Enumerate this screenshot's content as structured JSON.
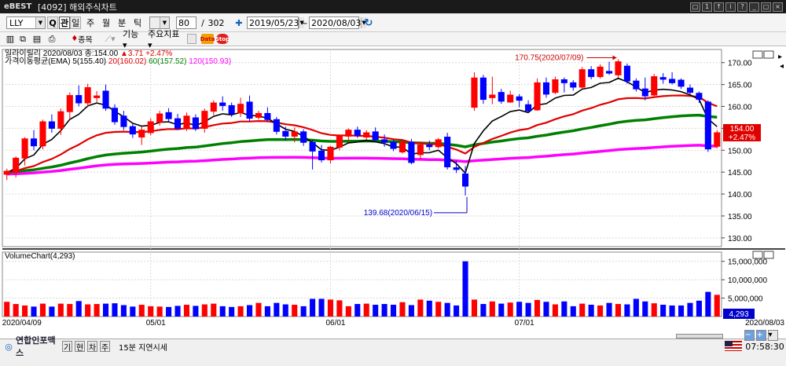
{
  "app": {
    "logo": "eBEST",
    "title": "[4092] 해외주식차트",
    "window_buttons": [
      "□",
      "1",
      "↑",
      "i",
      "?",
      "_",
      "▢",
      "×"
    ]
  },
  "toolbar": {
    "symbol": "LLY",
    "search_btn": "Q",
    "period_tabs": [
      "관",
      "일",
      "주",
      "월",
      "분",
      "틱"
    ],
    "active_tab": "일",
    "count": "80",
    "total": "302",
    "date_from": "2019/05/23",
    "date_to": "2020/08/03",
    "date_sep": "~",
    "menu_gi": "기능 ▾",
    "menu_indicator": "주요지표 ▾",
    "row2_small": "종목",
    "icon_data": "Data",
    "icon_stop": "Stop"
  },
  "legend": {
    "price_name": "일라이릴리",
    "price_info": "2020/08/03 종:154.00",
    "price_change": "▲3.71",
    "price_pct": "+2.47%",
    "ema_name": "가격이동평균(EMA)",
    "ema5": "5(155.40)",
    "ema20": "20(160.02)",
    "ema60": "60(157.52)",
    "ema120": "120(150.93)",
    "volume_title": "VolumeChart(4,293)"
  },
  "annotations": {
    "high": "170.75(2020/07/09)",
    "low": "139.68(2020/06/15)"
  },
  "price_box": {
    "value": "154.00",
    "pct": "+2.47%"
  },
  "volume_box": "4,293",
  "colors": {
    "up": "#ff0000",
    "down": "#0000ff",
    "ema5": "#000000",
    "ema20": "#e00000",
    "ema60": "#008000",
    "ema120": "#ff00ff"
  },
  "statusbar": {
    "brand": "연합인포맥스",
    "buttons": [
      "기",
      "현",
      "차",
      "주"
    ],
    "delay": "15분 지연시세",
    "time": "07:58:30"
  },
  "chart_data": [
    {
      "type": "candlestick",
      "title": "일라이릴리",
      "ylim": [
        128,
        173
      ],
      "y_ticks": [
        "170.00",
        "165.00",
        "160.00",
        "155.00",
        "150.00",
        "145.00",
        "140.00",
        "135.00",
        "130.00"
      ],
      "x_tick_labels": [
        "2020/04/09",
        "05/01",
        "06/01",
        "07/01",
        "2020/08/03"
      ],
      "candles": [
        {
          "date": "2020/04/09",
          "o": 144.5,
          "h": 145.8,
          "l": 143.2,
          "c": 145.2
        },
        {
          "date": "2020/04/13",
          "o": 145.0,
          "h": 148.6,
          "l": 143.8,
          "c": 148.2
        },
        {
          "date": "2020/04/14",
          "o": 148.2,
          "h": 153.0,
          "l": 146.5,
          "c": 152.6
        },
        {
          "date": "2020/04/15",
          "o": 152.6,
          "h": 154.6,
          "l": 150.0,
          "c": 151.0
        },
        {
          "date": "2020/04/16",
          "o": 151.0,
          "h": 157.0,
          "l": 150.2,
          "c": 156.5
        },
        {
          "date": "2020/04/17",
          "o": 156.5,
          "h": 158.2,
          "l": 154.0,
          "c": 155.0
        },
        {
          "date": "2020/04/20",
          "o": 155.0,
          "h": 159.5,
          "l": 153.5,
          "c": 158.8
        },
        {
          "date": "2020/04/21",
          "o": 158.8,
          "h": 163.2,
          "l": 157.0,
          "c": 162.5
        },
        {
          "date": "2020/04/22",
          "o": 162.5,
          "h": 164.8,
          "l": 160.0,
          "c": 160.8
        },
        {
          "date": "2020/04/23",
          "o": 160.8,
          "h": 165.2,
          "l": 159.8,
          "c": 164.3
        },
        {
          "date": "2020/04/24",
          "o": 162.0,
          "h": 163.5,
          "l": 161.0,
          "c": 162.4
        },
        {
          "date": "2020/04/27",
          "o": 163.5,
          "h": 165.0,
          "l": 159.0,
          "c": 159.6
        },
        {
          "date": "2020/04/28",
          "o": 159.6,
          "h": 160.5,
          "l": 155.8,
          "c": 156.5
        },
        {
          "date": "2020/04/29",
          "o": 157.8,
          "h": 159.0,
          "l": 154.6,
          "c": 155.4
        },
        {
          "date": "2020/04/30",
          "o": 155.4,
          "h": 156.0,
          "l": 152.8,
          "c": 153.7
        },
        {
          "date": "2020/05/01",
          "o": 153.0,
          "h": 155.4,
          "l": 151.2,
          "c": 154.6
        },
        {
          "date": "2020/05/04",
          "o": 154.0,
          "h": 157.3,
          "l": 153.4,
          "c": 156.5
        },
        {
          "date": "2020/05/05",
          "o": 156.4,
          "h": 159.0,
          "l": 155.6,
          "c": 158.3
        },
        {
          "date": "2020/05/06",
          "o": 158.6,
          "h": 159.6,
          "l": 156.6,
          "c": 157.2
        },
        {
          "date": "2020/05/07",
          "o": 157.2,
          "h": 158.3,
          "l": 154.6,
          "c": 155.0
        },
        {
          "date": "2020/05/08",
          "o": 155.0,
          "h": 158.6,
          "l": 154.4,
          "c": 157.8
        },
        {
          "date": "2020/05/11",
          "o": 157.4,
          "h": 158.2,
          "l": 154.4,
          "c": 154.9
        },
        {
          "date": "2020/05/12",
          "o": 155.0,
          "h": 159.5,
          "l": 154.0,
          "c": 158.9
        },
        {
          "date": "2020/05/13",
          "o": 158.9,
          "h": 161.4,
          "l": 158.0,
          "c": 160.8
        },
        {
          "date": "2020/05/14",
          "o": 160.8,
          "h": 162.3,
          "l": 159.0,
          "c": 160.2
        },
        {
          "date": "2020/05/15",
          "o": 160.2,
          "h": 160.9,
          "l": 157.6,
          "c": 158.3
        },
        {
          "date": "2020/05/18",
          "o": 158.5,
          "h": 162.0,
          "l": 157.6,
          "c": 160.5
        },
        {
          "date": "2020/05/19",
          "o": 161.0,
          "h": 162.5,
          "l": 156.5,
          "c": 157.3
        },
        {
          "date": "2020/05/20",
          "o": 157.5,
          "h": 159.0,
          "l": 157.0,
          "c": 158.4
        },
        {
          "date": "2020/05/21",
          "o": 158.4,
          "h": 159.8,
          "l": 156.6,
          "c": 157.0
        },
        {
          "date": "2020/05/22",
          "o": 157.0,
          "h": 157.6,
          "l": 153.6,
          "c": 154.3
        },
        {
          "date": "2020/05/26",
          "o": 154.3,
          "h": 155.4,
          "l": 152.2,
          "c": 153.2
        },
        {
          "date": "2020/05/27",
          "o": 153.2,
          "h": 155.2,
          "l": 151.8,
          "c": 154.2
        },
        {
          "date": "2020/05/28",
          "o": 154.2,
          "h": 154.8,
          "l": 151.0,
          "c": 151.8
        },
        {
          "date": "2020/05/29",
          "o": 151.8,
          "h": 152.4,
          "l": 145.6,
          "c": 149.8
        },
        {
          "date": "2020/06/01",
          "o": 149.8,
          "h": 151.2,
          "l": 147.2,
          "c": 147.8
        },
        {
          "date": "2020/06/02",
          "o": 147.8,
          "h": 151.0,
          "l": 147.0,
          "c": 150.7
        },
        {
          "date": "2020/06/03",
          "o": 150.7,
          "h": 153.6,
          "l": 150.0,
          "c": 153.2
        },
        {
          "date": "2020/06/04",
          "o": 153.2,
          "h": 155.0,
          "l": 152.0,
          "c": 154.6
        },
        {
          "date": "2020/06/05",
          "o": 154.6,
          "h": 155.4,
          "l": 152.8,
          "c": 153.4
        },
        {
          "date": "2020/06/08",
          "o": 153.0,
          "h": 154.6,
          "l": 152.4,
          "c": 154.0
        },
        {
          "date": "2020/06/09",
          "o": 154.2,
          "h": 155.2,
          "l": 152.0,
          "c": 152.4
        },
        {
          "date": "2020/06/10",
          "o": 152.4,
          "h": 153.6,
          "l": 150.8,
          "c": 151.8
        },
        {
          "date": "2020/06/11",
          "o": 151.8,
          "h": 152.4,
          "l": 149.8,
          "c": 150.4
        },
        {
          "date": "2020/06/12",
          "o": 149.6,
          "h": 152.2,
          "l": 149.2,
          "c": 151.8
        },
        {
          "date": "2020/06/15",
          "o": 151.8,
          "h": 152.6,
          "l": 146.8,
          "c": 147.2
        },
        {
          "date": "2020/06/16",
          "o": 149.0,
          "h": 152.0,
          "l": 147.8,
          "c": 151.2
        },
        {
          "date": "2020/06/17",
          "o": 151.2,
          "h": 152.2,
          "l": 150.0,
          "c": 150.8
        },
        {
          "date": "2020/06/18",
          "o": 150.8,
          "h": 152.8,
          "l": 150.4,
          "c": 152.4
        },
        {
          "date": "2020/06/19",
          "o": 153.0,
          "h": 154.0,
          "l": 145.6,
          "c": 146.2
        },
        {
          "date": "2020/06/22",
          "o": 146.0,
          "h": 147.6,
          "l": 144.8,
          "c": 145.6
        },
        {
          "date": "2020/06/23",
          "o": 144.6,
          "h": 146.4,
          "l": 139.68,
          "c": 141.8
        },
        {
          "date": "2020/06/24",
          "o": 159.8,
          "h": 167.8,
          "l": 159.0,
          "c": 166.5
        },
        {
          "date": "2020/06/25",
          "o": 166.5,
          "h": 167.2,
          "l": 160.6,
          "c": 161.6
        },
        {
          "date": "2020/06/26",
          "o": 162.0,
          "h": 166.8,
          "l": 160.5,
          "c": 162.6
        },
        {
          "date": "2020/06/29",
          "o": 163.2,
          "h": 164.0,
          "l": 160.6,
          "c": 161.2
        },
        {
          "date": "2020/06/30",
          "o": 161.0,
          "h": 163.6,
          "l": 160.8,
          "c": 162.6
        },
        {
          "date": "2020/07/01",
          "o": 162.2,
          "h": 162.8,
          "l": 159.8,
          "c": 161.4
        },
        {
          "date": "2020/07/02",
          "o": 160.4,
          "h": 161.4,
          "l": 158.6,
          "c": 159.0
        },
        {
          "date": "2020/07/06",
          "o": 159.2,
          "h": 166.4,
          "l": 159.0,
          "c": 165.4
        },
        {
          "date": "2020/07/07",
          "o": 165.4,
          "h": 166.6,
          "l": 162.0,
          "c": 162.8
        },
        {
          "date": "2020/07/08",
          "o": 163.2,
          "h": 166.8,
          "l": 162.8,
          "c": 166.1
        },
        {
          "date": "2020/07/09",
          "o": 166.1,
          "h": 166.6,
          "l": 163.2,
          "c": 165.4
        },
        {
          "date": "2020/07/10",
          "o": 165.4,
          "h": 166.0,
          "l": 163.6,
          "c": 164.4
        },
        {
          "date": "2020/07/13",
          "o": 164.4,
          "h": 169.0,
          "l": 164.0,
          "c": 168.4
        },
        {
          "date": "2020/07/14",
          "o": 168.4,
          "h": 169.2,
          "l": 166.2,
          "c": 166.8
        },
        {
          "date": "2020/07/15",
          "o": 166.8,
          "h": 169.6,
          "l": 166.4,
          "c": 169.0
        },
        {
          "date": "2020/07/16",
          "o": 168.0,
          "h": 170.2,
          "l": 167.2,
          "c": 167.6
        },
        {
          "date": "2020/07/17",
          "o": 167.2,
          "h": 170.75,
          "l": 166.6,
          "c": 170.2
        },
        {
          "date": "2020/07/20",
          "o": 169.2,
          "h": 169.8,
          "l": 165.2,
          "c": 165.8
        },
        {
          "date": "2020/07/21",
          "o": 165.8,
          "h": 166.4,
          "l": 163.4,
          "c": 164.0
        },
        {
          "date": "2020/07/22",
          "o": 164.0,
          "h": 166.6,
          "l": 161.4,
          "c": 162.4
        },
        {
          "date": "2020/07/23",
          "o": 162.6,
          "h": 167.4,
          "l": 162.2,
          "c": 166.8
        },
        {
          "date": "2020/07/24",
          "o": 166.6,
          "h": 167.6,
          "l": 165.2,
          "c": 166.2
        },
        {
          "date": "2020/07/27",
          "o": 166.2,
          "h": 167.8,
          "l": 165.0,
          "c": 165.4
        },
        {
          "date": "2020/07/28",
          "o": 166.0,
          "h": 166.4,
          "l": 164.0,
          "c": 164.6
        },
        {
          "date": "2020/07/29",
          "o": 164.2,
          "h": 165.0,
          "l": 162.8,
          "c": 163.2
        },
        {
          "date": "2020/07/30",
          "o": 163.0,
          "h": 163.4,
          "l": 160.8,
          "c": 161.6
        },
        {
          "date": "2020/07/31",
          "o": 161.0,
          "h": 161.4,
          "l": 149.6,
          "c": 150.29
        },
        {
          "date": "2020/08/03",
          "o": 150.9,
          "h": 154.6,
          "l": 150.4,
          "c": 154.0
        }
      ],
      "ema": [
        {
          "name": "5",
          "end": 155.4
        },
        {
          "name": "20",
          "end": 160.02
        },
        {
          "name": "60",
          "end": 157.52
        },
        {
          "name": "120",
          "end": 150.93
        }
      ]
    },
    {
      "type": "bar",
      "title": "VolumeChart(4,293)",
      "ylim": [
        0,
        17500000
      ],
      "y_ticks": [
        "15,000,000",
        "10,000,000",
        "5,000,000"
      ],
      "volumes": [
        4000000,
        3400000,
        3000000,
        2700000,
        3500000,
        2700000,
        3500000,
        3400000,
        4200000,
        3300000,
        3400000,
        3500000,
        3600000,
        3100000,
        2700000,
        3200000,
        2800000,
        2700000,
        2600000,
        2900000,
        3200000,
        2900000,
        3300000,
        3500000,
        2800000,
        2600000,
        2800000,
        3100000,
        3700000,
        2800000,
        3700000,
        3300000,
        3200000,
        2800000,
        4800000,
        4800000,
        4600000,
        4400000,
        2800000,
        3400000,
        3500000,
        3200000,
        3400000,
        3200000,
        3900000,
        3100000,
        4600000,
        4300000,
        4000000,
        3700000,
        3000000,
        15000000,
        4600000,
        3400000,
        4100000,
        3500000,
        3800000,
        4000000,
        3700000,
        4500000,
        4000000,
        3300000,
        4100000,
        2800000,
        3500000,
        3200000,
        3000000,
        3700000,
        3400000,
        3300000,
        4800000,
        4100000,
        3600000,
        3200000,
        3000000,
        3000000,
        3700000,
        4300000,
        6700000,
        5900000
      ]
    }
  ]
}
